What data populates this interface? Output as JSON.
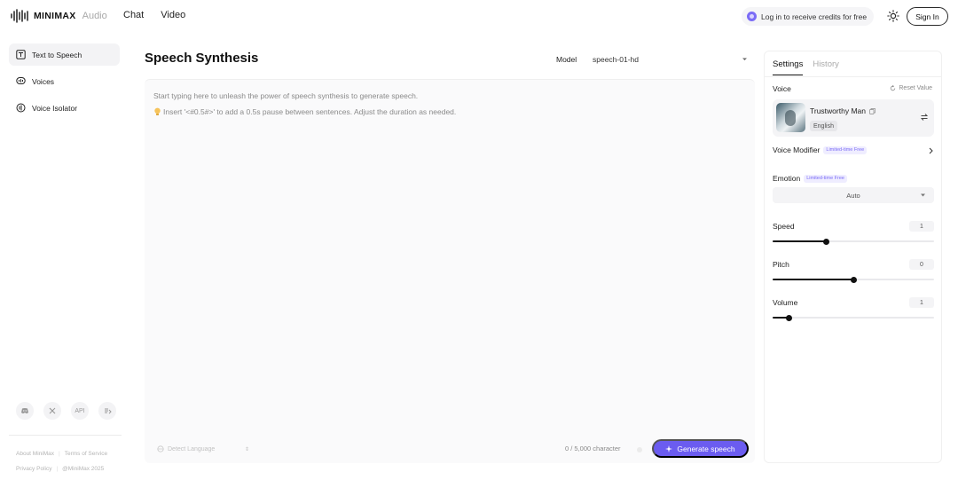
{
  "header": {
    "brand": "MINIMAX",
    "brand_sub": "Audio",
    "nav": [
      "Chat",
      "Video"
    ],
    "credits_text": "Log in to receive credits for free",
    "signin_label": "Sign In"
  },
  "sidebar": {
    "items": [
      {
        "label": "Text to Speech",
        "icon": "text-to-speech-icon",
        "active": true
      },
      {
        "label": "Voices",
        "icon": "voices-icon",
        "active": false
      },
      {
        "label": "Voice Isolator",
        "icon": "voice-isolator-icon",
        "active": false
      }
    ],
    "social": {
      "api_label": "API"
    },
    "footer": {
      "about": "About MiniMax",
      "terms": "Terms of Service",
      "privacy": "Privacy Policy",
      "copyright": "@MiniMax 2025"
    }
  },
  "main": {
    "title": "Speech Synthesis",
    "model_label": "Model",
    "model_value": "speech-01-hd",
    "editor_placeholder": "Start typing here to unleash the power of speech synthesis to generate speech.",
    "editor_tip": "Insert '<#0.5#>' to add a 0.5s pause between sentences. Adjust the duration as needed.",
    "detect_language": "Detect Language",
    "char_count": "0 / 5,000 character",
    "generate_label": "Generate speech",
    "accent": "#6b5cf0"
  },
  "panel": {
    "tabs": [
      "Settings",
      "History"
    ],
    "voice_label": "Voice",
    "reset_label": "Reset Value",
    "voice_name": "Trustworthy Man",
    "voice_language": "English",
    "modifier_label": "Voice Modifier",
    "badge_text": "Limited-time Free",
    "emotion_label": "Emotion",
    "emotion_value": "Auto",
    "sliders": [
      {
        "label": "Speed",
        "value": "1",
        "fraction": 0.33
      },
      {
        "label": "Pitch",
        "value": "0",
        "fraction": 0.5
      },
      {
        "label": "Volume",
        "value": "1",
        "fraction": 0.1
      }
    ]
  }
}
